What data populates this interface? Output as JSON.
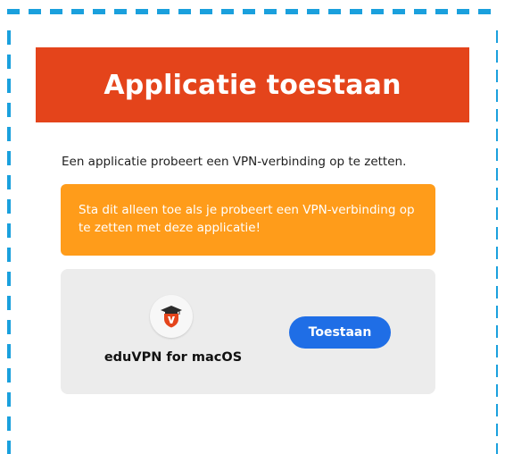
{
  "dialog": {
    "title": "Applicatie toestaan",
    "intro": "Een applicatie probeert een VPN-verbinding op te zetten.",
    "warning": "Sta dit alleen toe als je probeert een VPN-verbinding op te zetten met deze applicatie!"
  },
  "app": {
    "name": "eduVPN for macOS",
    "icon": "eduvpn-logo-icon"
  },
  "actions": {
    "allow_label": "Toestaan"
  },
  "colors": {
    "header": "#e4441b",
    "warning": "#ff9c1a",
    "button": "#1f6ee6",
    "panel": "#ececec",
    "dashed_border": "#1aa0dd"
  }
}
